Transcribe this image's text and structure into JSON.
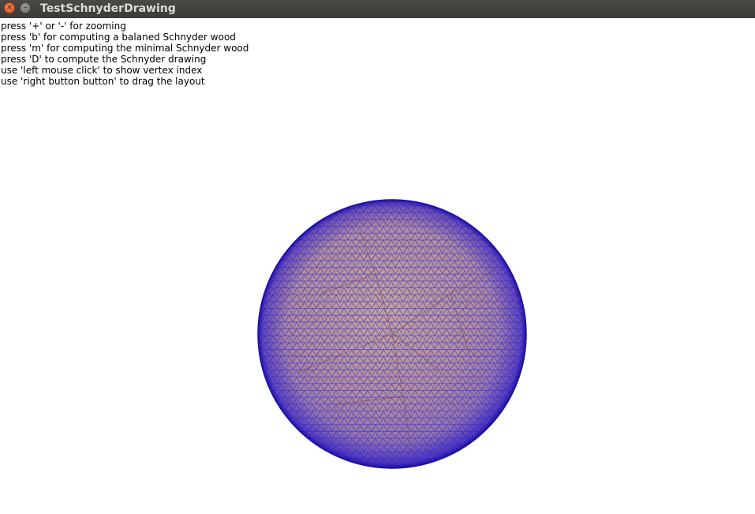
{
  "window": {
    "title": "TestSchnyderDrawing",
    "close_glyph": "×",
    "minimize_glyph": "–"
  },
  "instructions": [
    "press '+' or '-' for zooming",
    "press 'b' for computing a balaned Schnyder wood",
    "press 'm' for computing the minimal Schnyder wood",
    "press 'D' to compute the Schnyder drawing",
    "use 'left mouse click' to show vertex index",
    "use 'right button button' to drag the layout"
  ],
  "colors": {
    "titlebar": "#3c3b37",
    "mesh_blue": "#1a1ae6",
    "mesh_red": "#e6202a",
    "face_fill": "#b49aa0",
    "background": "#ffffff"
  }
}
